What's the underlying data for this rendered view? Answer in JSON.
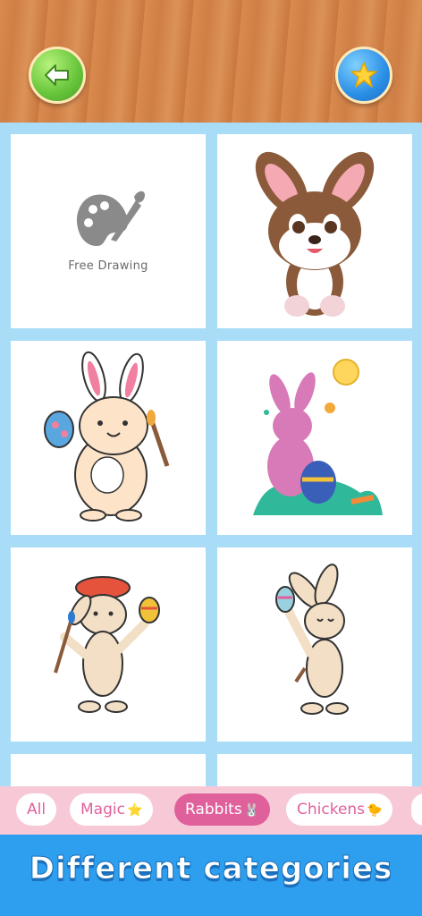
{
  "header": {
    "back_button_icon": "back-arrow-icon",
    "magic_button_icon": "star-icon"
  },
  "grid": {
    "free_drawing_label": "Free Drawing",
    "items": [
      {
        "name": "free-drawing",
        "icon": "palette-brush-icon"
      },
      {
        "name": "brown-bunny-sitting"
      },
      {
        "name": "bunny-with-egg-and-brush"
      },
      {
        "name": "pink-bunny-with-easter-egg"
      },
      {
        "name": "bunny-painter-with-beret"
      },
      {
        "name": "bunny-holding-egg"
      }
    ]
  },
  "categories": [
    {
      "label": "All",
      "emoji": "",
      "active": false
    },
    {
      "label": "Magic",
      "emoji": "⭐",
      "active": false
    },
    {
      "label": "Rabbits",
      "emoji": "🐰",
      "active": true
    },
    {
      "label": "Chickens",
      "emoji": "🐤",
      "active": false
    }
  ],
  "footer": {
    "title": "Different categories"
  },
  "colors": {
    "background": "#a9dcf7",
    "accent_pink": "#e0609c",
    "footer_blue": "#2e9eee",
    "back_button_green": "#66c43a",
    "star_button_blue": "#2b8fe6"
  }
}
